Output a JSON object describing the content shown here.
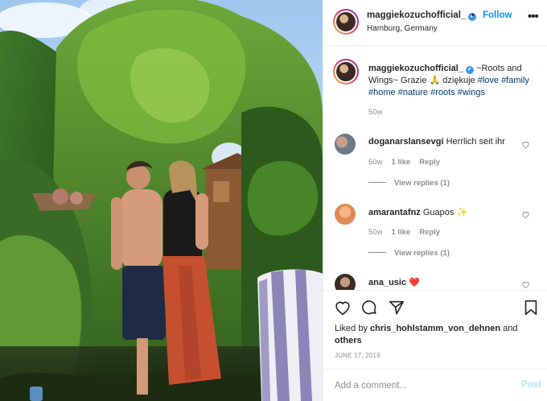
{
  "post": {
    "username": "maggiekozuchofficial_",
    "verified_mark": "✔",
    "separator": "•",
    "follow_label": "Follow",
    "location": "Hamburg, Germany",
    "more_icon": "more-icon"
  },
  "caption": {
    "username": "maggiekozuchofficial_",
    "text_start": "~Roots and Wings~ Grazie",
    "emoji": "🙏",
    "text_mid": "dziękuje",
    "hashtags": [
      "#love",
      "#family",
      "#home",
      "#nature",
      "#roots",
      "#wings"
    ],
    "age": "50w"
  },
  "comments": [
    {
      "username": "doganarslansevgi",
      "text": "Herrlich seit ihr",
      "age": "50w",
      "likes": "1 like",
      "reply_label": "Reply",
      "view_replies": "View replies (1)"
    },
    {
      "username": "amarantafnz",
      "text": "Guapos",
      "emoji": "✨",
      "age": "50w",
      "likes": "1 like",
      "reply_label": "Reply",
      "view_replies": "View replies (1)"
    },
    {
      "username": "ana_usic",
      "emoji": "❤️"
    }
  ],
  "actions": {
    "liked_by_prefix": "Liked by",
    "liked_by_user": "chris_hohlstamm_von_dehnen",
    "and": "and",
    "others": "others",
    "date": "JUNE 17, 2019"
  },
  "add_comment": {
    "placeholder": "Add a comment...",
    "post_label": "Post"
  },
  "colors": {
    "link_blue": "#0095f6",
    "hashtag": "#00376b",
    "muted": "#8e8e8e",
    "verified": "#3897f0"
  }
}
